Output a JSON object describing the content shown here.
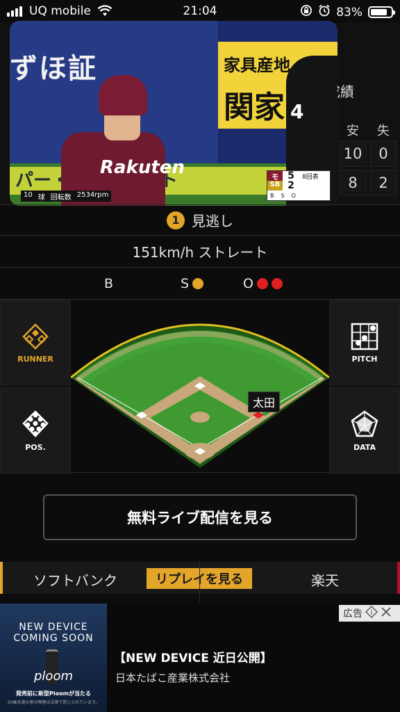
{
  "status_bar": {
    "carrier": "UQ mobile",
    "time": "21:04",
    "battery": "83%",
    "battery_level": 0.83
  },
  "stats_bg": {
    "label": "成績",
    "headers": [
      "安",
      "失"
    ],
    "rows": [
      [
        "10",
        "0"
      ],
      [
        "8",
        "2"
      ]
    ]
  },
  "video": {
    "sign_left": "ずほ証",
    "sign_right_top": "家具産地",
    "sign_right_bottom": "関家",
    "banner": "パー・競輪・オート",
    "jersey": "Rakuten",
    "ump_number": "4",
    "info": [
      "10",
      "球",
      "回転数",
      "2534rpm"
    ],
    "score": {
      "team1": "モ",
      "team1_score": "5",
      "team2": "SB",
      "team2_score": "2",
      "inning": "8回表",
      "count": [
        "B",
        "S",
        "O"
      ]
    }
  },
  "pitch": {
    "number": "1",
    "result": "見逃し",
    "speed_type": "151km/h ストレート"
  },
  "count": {
    "b_label": "B",
    "s_label": "S",
    "o_label": "O",
    "balls": 0,
    "strikes": 1,
    "outs": 2,
    "strike_color": "#e3a52a",
    "out_color": "#e02020"
  },
  "side_buttons": {
    "runner": "RUNNER",
    "pitch": "PITCH",
    "pos": "POS.",
    "data": "DATA"
  },
  "field": {
    "runner_name": "太田"
  },
  "live_button": "無料ライブ配信を見る",
  "teams": {
    "left": "ソフトバンク",
    "replay": "リプレイを見る",
    "right": "楽天",
    "left_color": "#e3a52a",
    "right_color": "#b2112d"
  },
  "ad": {
    "badge": "広告",
    "image_line1": "NEW DEVICE",
    "image_line2": "COMING SOON",
    "image_brand": "ploom",
    "image_line3": "発売前に新型Ploomが当たる",
    "image_line4": "20歳未満の者の喫煙は法律で禁じられています。",
    "title": "【NEW DEVICE 近日公開】",
    "sponsor": "日本たばこ産業株式会社"
  }
}
